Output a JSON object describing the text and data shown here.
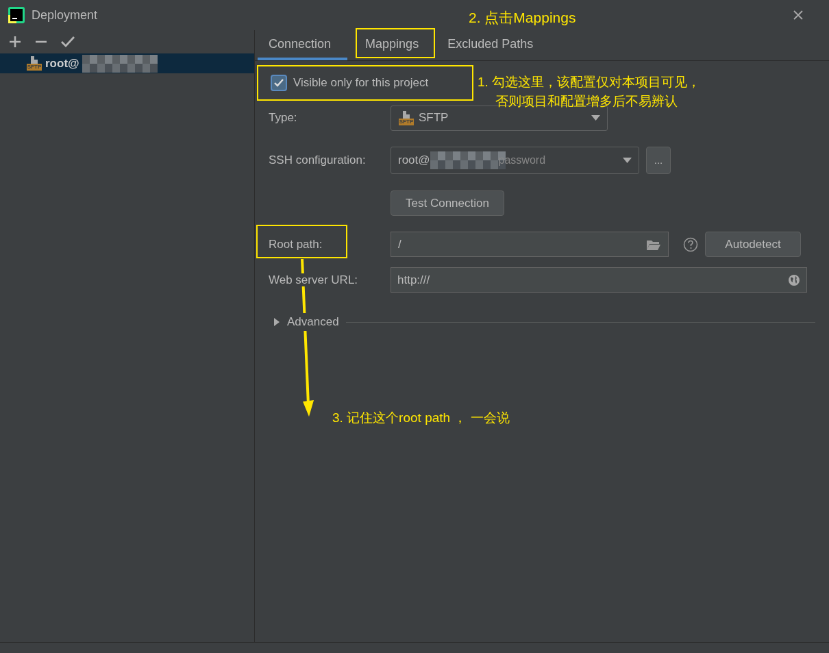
{
  "window": {
    "title": "Deployment"
  },
  "sidebar": {
    "items": [
      {
        "label": "root@",
        "type": "SFTP",
        "selected": true
      }
    ]
  },
  "tabs": [
    {
      "label": "Connection",
      "selected": true
    },
    {
      "label": "Mappings",
      "selected": false
    },
    {
      "label": "Excluded Paths",
      "selected": false
    }
  ],
  "visible_only": {
    "label": "Visible only for this project",
    "checked": true
  },
  "type": {
    "label": "Type:",
    "value": "SFTP",
    "badge": "SFTP"
  },
  "ssh": {
    "label": "SSH configuration:",
    "value": "root@",
    "suffix": "password",
    "more": "..."
  },
  "test_button": "Test Connection",
  "root_path": {
    "label": "Root path:",
    "value": "/",
    "button": "Autodetect"
  },
  "web_url": {
    "label": "Web server URL:",
    "value": "http:///"
  },
  "advanced": {
    "label": "Advanced",
    "expanded": false
  },
  "annotations": [
    {
      "kind": "title",
      "text": "2. 点击Mappings"
    },
    {
      "kind": "note",
      "lines": [
        "1. 勾选这里，该配置仅对本项目可见，",
        "否则项目和配置增多后不易辨认"
      ]
    },
    {
      "kind": "arrow_note",
      "text": "3. 记住这个root path ， 一会说"
    }
  ]
}
